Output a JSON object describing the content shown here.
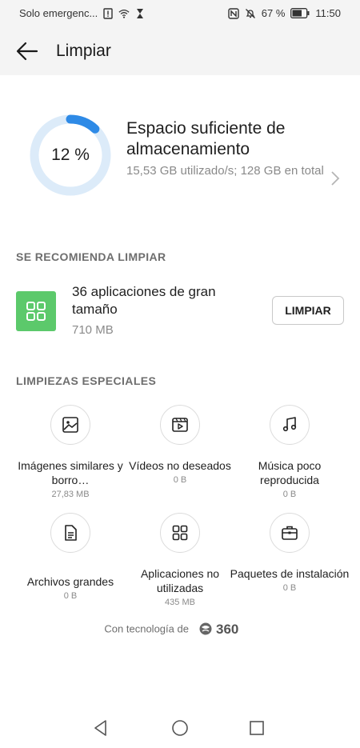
{
  "status_bar": {
    "carrier": "Solo emergenc...",
    "battery": "67 %",
    "time": "11:50"
  },
  "app_bar": {
    "title": "Limpiar"
  },
  "storage": {
    "percent_label": "12 %",
    "used_fraction": 0.12,
    "title": "Espacio suficiente de almacenamiento",
    "detail": "15,53 GB utilizado/s; 128 GB en total"
  },
  "recommended": {
    "header": "SE RECOMIENDA LIMPIAR",
    "item_title": "36 aplicaciones de gran tamaño",
    "item_size": "710 MB",
    "button_label": "LIMPIAR"
  },
  "special": {
    "header": "LIMPIEZAS ESPECIALES",
    "tools": [
      {
        "name": "Imágenes similares y borro…",
        "size": "27,83 MB",
        "icon": "image-icon"
      },
      {
        "name": "Vídeos no deseados",
        "size": "0 B",
        "icon": "video-icon"
      },
      {
        "name": "Música poco reproducida",
        "size": "0 B",
        "icon": "music-note-icon"
      },
      {
        "name": "Archivos grandes",
        "size": "0 B",
        "icon": "document-icon"
      },
      {
        "name": "Aplicaciones no utilizadas",
        "size": "435 MB",
        "icon": "apps-grid-icon"
      },
      {
        "name": "Paquetes de instalación",
        "size": "0 B",
        "icon": "briefcase-icon"
      }
    ]
  },
  "footer": {
    "powered_by": "Con tecnología de",
    "brand": "360"
  },
  "colors": {
    "accent_blue": "#2e8ae6",
    "ring_track": "#dcebf9",
    "app_tile_green": "#5cc96b",
    "bar_background": "#f4f4f4"
  }
}
